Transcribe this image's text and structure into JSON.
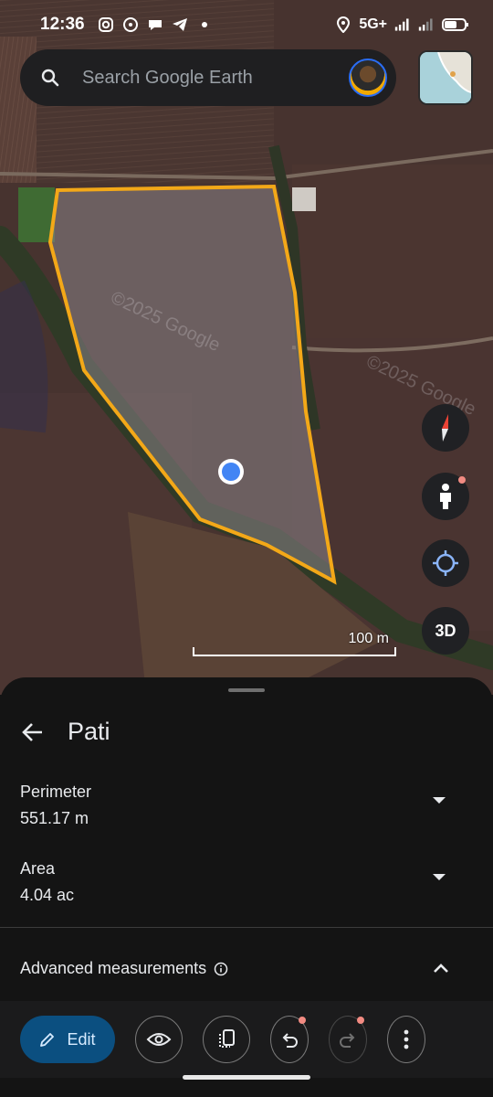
{
  "status_bar": {
    "time": "12:36",
    "network": "5G+",
    "icons": [
      "instagram-icon",
      "whatsapp-icon",
      "chat-icon",
      "telegram-icon",
      "dot-icon",
      "location-icon",
      "signal-icon",
      "battery-icon"
    ]
  },
  "search": {
    "placeholder": "Search Google Earth"
  },
  "map": {
    "scale_label": "100 m",
    "watermark_1": "©2025 Google",
    "watermark_2": "©2025 Google",
    "compass_label": "",
    "mode_3d_label": "3D",
    "polygon_color": "#f3a818",
    "location_color": "#4285f4"
  },
  "sheet": {
    "title": "Pati",
    "measurements": [
      {
        "label": "Perimeter",
        "value": "551.17 m"
      },
      {
        "label": "Area",
        "value": "4.04 ac"
      }
    ],
    "advanced_label": "Advanced measurements"
  },
  "toolbar": {
    "edit_label": "Edit"
  },
  "colors": {
    "accent": "#0b4f80",
    "sheet_bg": "#141414",
    "badge": "#f28b82"
  }
}
